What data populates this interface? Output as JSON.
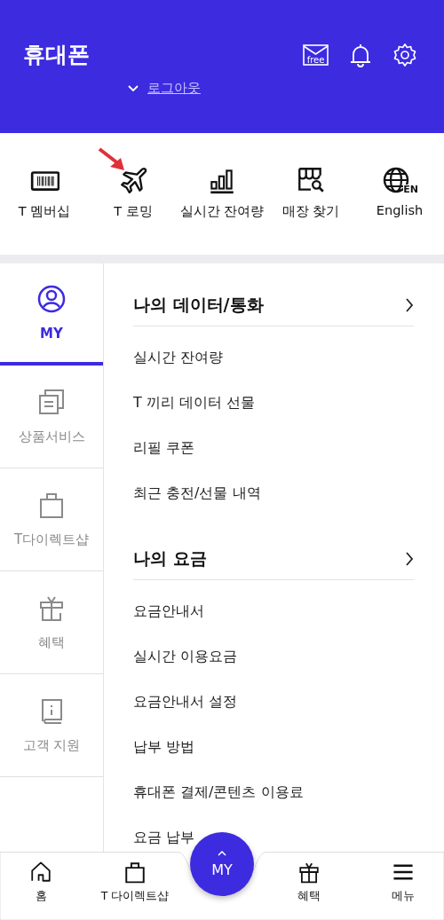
{
  "header": {
    "title": "휴대폰",
    "mail_badge": "free",
    "logout_link": "로그아웃"
  },
  "quick_menu": [
    {
      "label": "T 멤버십"
    },
    {
      "label": "T 로밍"
    },
    {
      "label": "실시간 잔여량"
    },
    {
      "label": "매장 찾기"
    },
    {
      "label": "English",
      "badge": "EN"
    }
  ],
  "sidebar": [
    {
      "label": "MY",
      "selected": true
    },
    {
      "label": "상품서비스",
      "selected": false
    },
    {
      "label": "T다이렉트샵",
      "selected": false
    },
    {
      "label": "혜택",
      "selected": false
    },
    {
      "label": "고객 지원",
      "selected": false
    }
  ],
  "sections": [
    {
      "title": "나의 데이터/통화",
      "items": [
        "실시간 잔여량",
        "T 끼리 데이터 선물",
        "리필 쿠폰",
        "최근 충전/선물 내역"
      ]
    },
    {
      "title": "나의 요금",
      "items": [
        "요금안내서",
        "실시간 이용요금",
        "요금안내서 설정",
        "납부 방법",
        "휴대폰 결제/콘텐츠 이용료",
        "요금 납부"
      ]
    }
  ],
  "bottom_nav": {
    "items": [
      {
        "label": "홈"
      },
      {
        "label": "T 다이렉트샵"
      },
      {
        "label": "혜택"
      },
      {
        "label": "메뉴"
      }
    ],
    "center_button": "MY"
  }
}
